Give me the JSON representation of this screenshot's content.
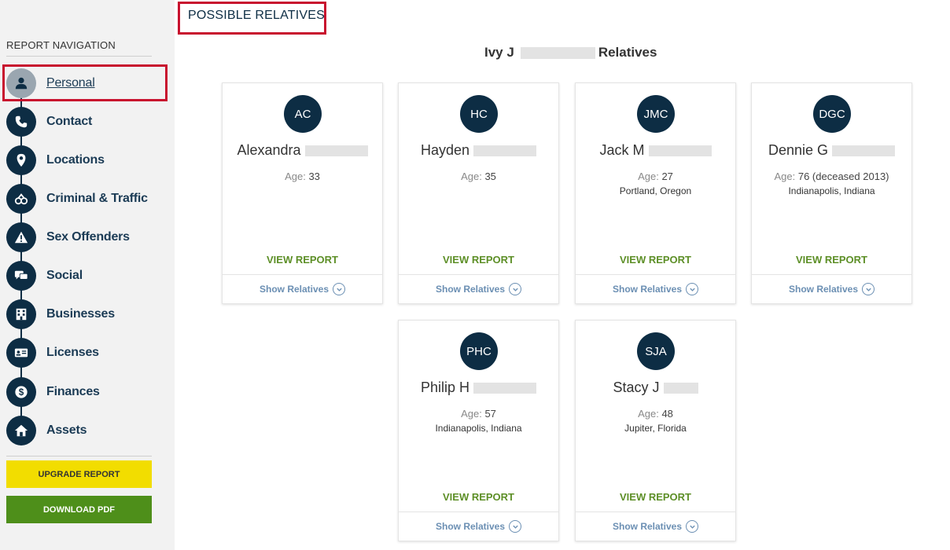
{
  "sidebar": {
    "title": "REPORT NAVIGATION",
    "items": [
      {
        "label": "Personal",
        "icon": "person-icon"
      },
      {
        "label": "Contact",
        "icon": "phone-icon"
      },
      {
        "label": "Locations",
        "icon": "map-pin-icon"
      },
      {
        "label": "Criminal & Traffic",
        "icon": "handcuffs-icon"
      },
      {
        "label": "Sex Offenders",
        "icon": "warning-icon"
      },
      {
        "label": "Social",
        "icon": "chat-icon"
      },
      {
        "label": "Businesses",
        "icon": "building-icon"
      },
      {
        "label": "Licenses",
        "icon": "id-card-icon"
      },
      {
        "label": "Finances",
        "icon": "dollar-icon"
      },
      {
        "label": "Assets",
        "icon": "home-icon"
      }
    ],
    "upgrade_label": "UPGRADE REPORT",
    "download_label": "DOWNLOAD PDF"
  },
  "main": {
    "section_title": "POSSIBLE RELATIVES",
    "heading_first": "Ivy J",
    "heading_suffix": "Relatives",
    "view_report_label": "VIEW REPORT",
    "show_relatives_label": "Show Relatives",
    "age_prefix": "Age:",
    "cards": [
      {
        "initials": "AC",
        "name": "Alexandra",
        "age": "33",
        "location": ""
      },
      {
        "initials": "HC",
        "name": "Hayden",
        "age": "35",
        "location": ""
      },
      {
        "initials": "JMC",
        "name": "Jack M",
        "age": "27",
        "location": "Portland, Oregon"
      },
      {
        "initials": "DGC",
        "name": "Dennie G",
        "age": "76 (deceased 2013)",
        "location": "Indianapolis, Indiana"
      },
      {
        "initials": "PHC",
        "name": "Philip H",
        "age": "57",
        "location": "Indianapolis, Indiana"
      },
      {
        "initials": "SJA",
        "name": "Stacy J",
        "age": "48",
        "location": "Jupiter, Florida"
      }
    ]
  },
  "colors": {
    "navy": "#0d2d44",
    "highlight_red": "#c8102e",
    "view_report_green": "#5d8f27",
    "upgrade_yellow": "#f2dd00",
    "download_green": "#4e8f1a",
    "link_blue": "#6b8fb3"
  }
}
